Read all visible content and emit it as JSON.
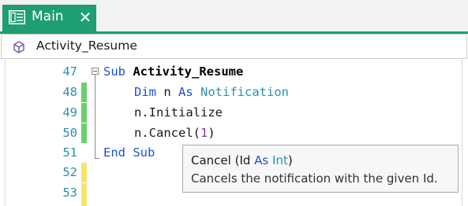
{
  "tab": {
    "label": "Main",
    "close": "✕"
  },
  "member_bar": {
    "label": "Activity_Resume"
  },
  "editor": {
    "lines": [
      {
        "num": "47",
        "kw1": "Sub",
        "name": "Activity_Resume"
      },
      {
        "num": "48",
        "dim": "Dim",
        "var": " n ",
        "as": "As",
        "type": "Notification"
      },
      {
        "num": "49",
        "text": "n.Initialize"
      },
      {
        "num": "50",
        "pre": "n.Cancel(",
        "arg": "1",
        "post": ")"
      },
      {
        "num": "51",
        "end": "End Sub"
      },
      {
        "num": "52"
      },
      {
        "num": "53"
      }
    ]
  },
  "tooltip": {
    "method": "Cancel",
    "open": " (Id ",
    "as": "As",
    "space": " ",
    "type": "Int",
    "close": ")",
    "description": "Cancels the notification with the given Id."
  },
  "colors": {
    "accent": "#1e9e71",
    "keyword": "#1f4fd0",
    "type": "#2b91af",
    "changed_saved": "#6bd06b",
    "changed_unsaved": "#f5e56b"
  }
}
